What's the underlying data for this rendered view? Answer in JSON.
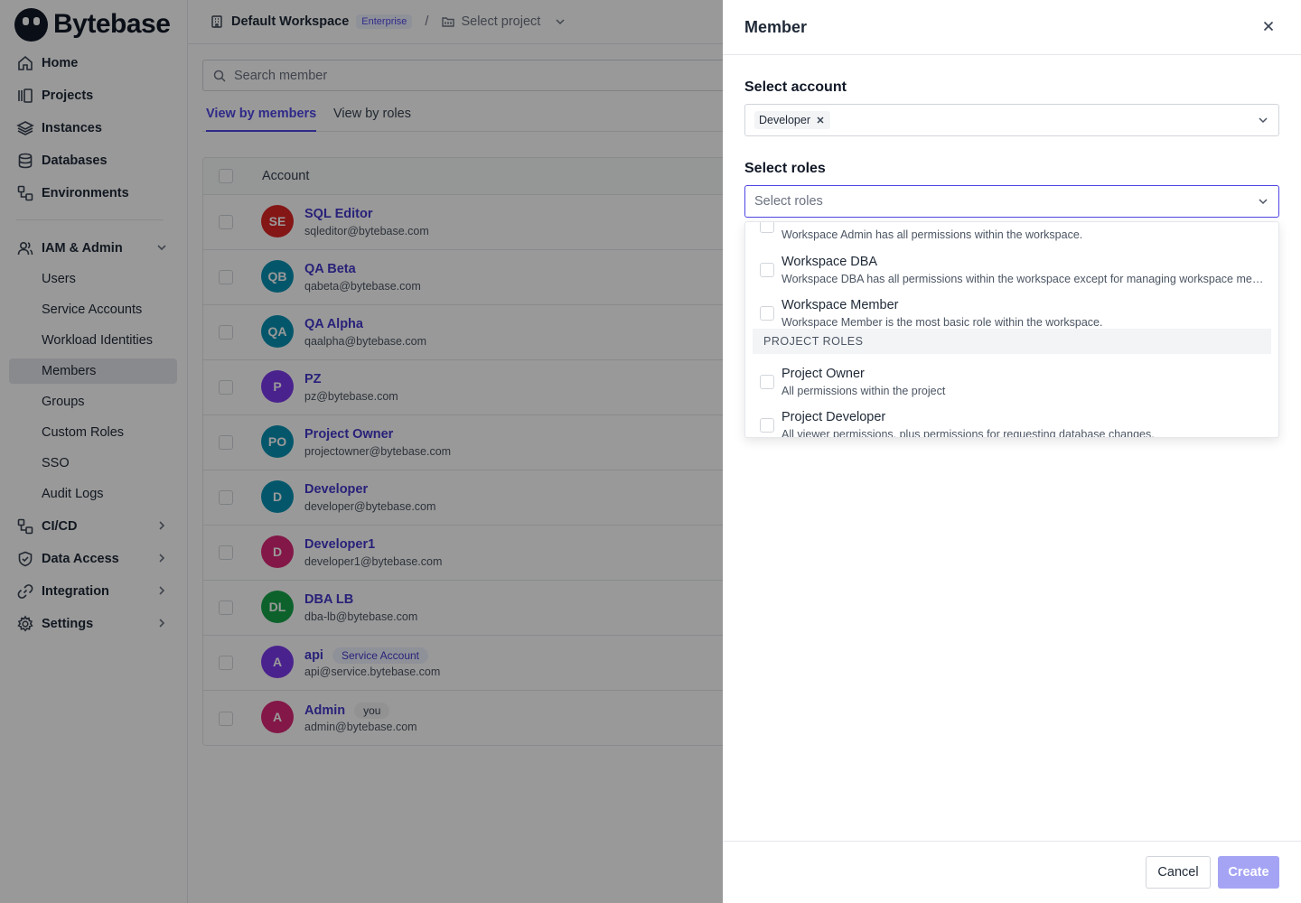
{
  "app": {
    "name": "Bytebase"
  },
  "sidebar": {
    "items": [
      {
        "label": "Home",
        "icon": "home-icon"
      },
      {
        "label": "Projects",
        "icon": "projects-icon"
      },
      {
        "label": "Instances",
        "icon": "layers-icon"
      },
      {
        "label": "Databases",
        "icon": "database-icon"
      },
      {
        "label": "Environments",
        "icon": "environments-icon"
      }
    ],
    "iam": {
      "label": "IAM & Admin",
      "sub_items": [
        "Users",
        "Service Accounts",
        "Workload Identities",
        "Members",
        "Groups",
        "Custom Roles",
        "SSO",
        "Audit Logs"
      ],
      "active": "Members"
    },
    "bottom_items": [
      {
        "label": "CI/CD"
      },
      {
        "label": "Data Access"
      },
      {
        "label": "Integration"
      },
      {
        "label": "Settings"
      }
    ]
  },
  "header": {
    "workspace": "Default Workspace",
    "plan_badge": "Enterprise",
    "separator": "/",
    "project_select": "Select project"
  },
  "main": {
    "search_placeholder": "Search member",
    "tabs": [
      "View by members",
      "View by roles"
    ],
    "active_tab": "View by members",
    "table_header": "Account",
    "members": [
      {
        "initials": "SE",
        "name": "SQL Editor",
        "email": "sqleditor@bytebase.com",
        "color": "#dc2626"
      },
      {
        "initials": "QB",
        "name": "QA Beta",
        "email": "qabeta@bytebase.com",
        "color": "#0891b2"
      },
      {
        "initials": "QA",
        "name": "QA Alpha",
        "email": "qaalpha@bytebase.com",
        "color": "#0891b2"
      },
      {
        "initials": "P",
        "name": "PZ",
        "email": "pz@bytebase.com",
        "color": "#7c3aed"
      },
      {
        "initials": "PO",
        "name": "Project Owner",
        "email": "projectowner@bytebase.com",
        "color": "#0891b2"
      },
      {
        "initials": "D",
        "name": "Developer",
        "email": "developer@bytebase.com",
        "color": "#0891b2"
      },
      {
        "initials": "D",
        "name": "Developer1",
        "email": "developer1@bytebase.com",
        "color": "#db2777"
      },
      {
        "initials": "DL",
        "name": "DBA LB",
        "email": "dba-lb@bytebase.com",
        "color": "#16a34a"
      },
      {
        "initials": "A",
        "name": "api",
        "email": "api@service.bytebase.com",
        "color": "#7c3aed",
        "tag": "Service Account"
      },
      {
        "initials": "A",
        "name": "Admin",
        "email": "admin@bytebase.com",
        "color": "#db2777",
        "tag": "you"
      }
    ]
  },
  "drawer": {
    "title": "Member",
    "account_label": "Select account",
    "selected_account": "Developer",
    "roles_label": "Select roles",
    "roles_placeholder": "Select roles",
    "dropdown": {
      "partial_desc": "Workspace Admin has all permissions within the workspace.",
      "workspace_options": [
        {
          "title": "Workspace DBA",
          "desc": "Workspace DBA has all permissions within the workspace except for managing workspace members and roles."
        },
        {
          "title": "Workspace Member",
          "desc": "Workspace Member is the most basic role within the workspace."
        }
      ],
      "group_label": "PROJECT ROLES",
      "project_options": [
        {
          "title": "Project Owner",
          "desc": "All permissions within the project"
        },
        {
          "title": "Project Developer",
          "desc": "All viewer permissions, plus permissions for requesting database changes."
        }
      ]
    },
    "cancel_label": "Cancel",
    "create_label": "Create"
  }
}
